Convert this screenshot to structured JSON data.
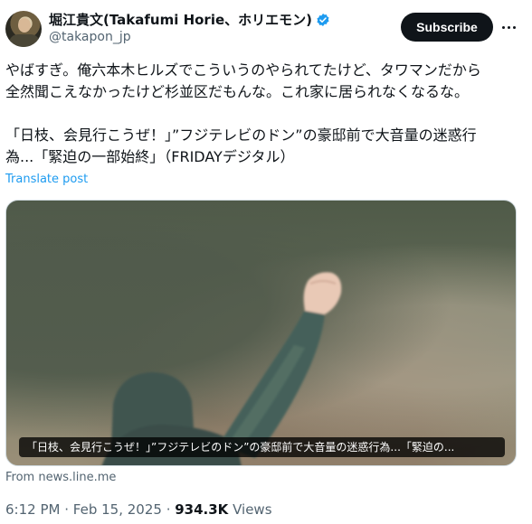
{
  "author": {
    "name": "堀江貴文(Takafumi Horie、ホリエモン)",
    "handle": "@takapon_jp",
    "subscribe_label": "Subscribe"
  },
  "post": {
    "line1": "やばすぎ。俺六本木ヒルズでこういうのやられてたけど、タワマンだから",
    "line2": "全然聞こえなかったけど杉並区だもんな。これ家に居られなくなるな。",
    "line3": "「日枝、会見行こうぜ！」”フジテレビのドン”の豪邸前で大音量の迷惑行",
    "line4": "為...「緊迫の一部始終」（FRIDAYデジタル）",
    "translate_label": "Translate post"
  },
  "card": {
    "caption": "「日枝、会見行こうぜ！」”フジテレビのドン”の豪邸前で大音量の迷惑行為...「緊迫の...",
    "source": "From news.line.me"
  },
  "meta": {
    "time": "6:12 PM",
    "date": "Feb 15, 2025",
    "views_count": "934.3K",
    "views_label": "Views"
  },
  "colors": {
    "accent": "#1d9bf0",
    "text": "#0f1419",
    "secondary": "#536471"
  }
}
